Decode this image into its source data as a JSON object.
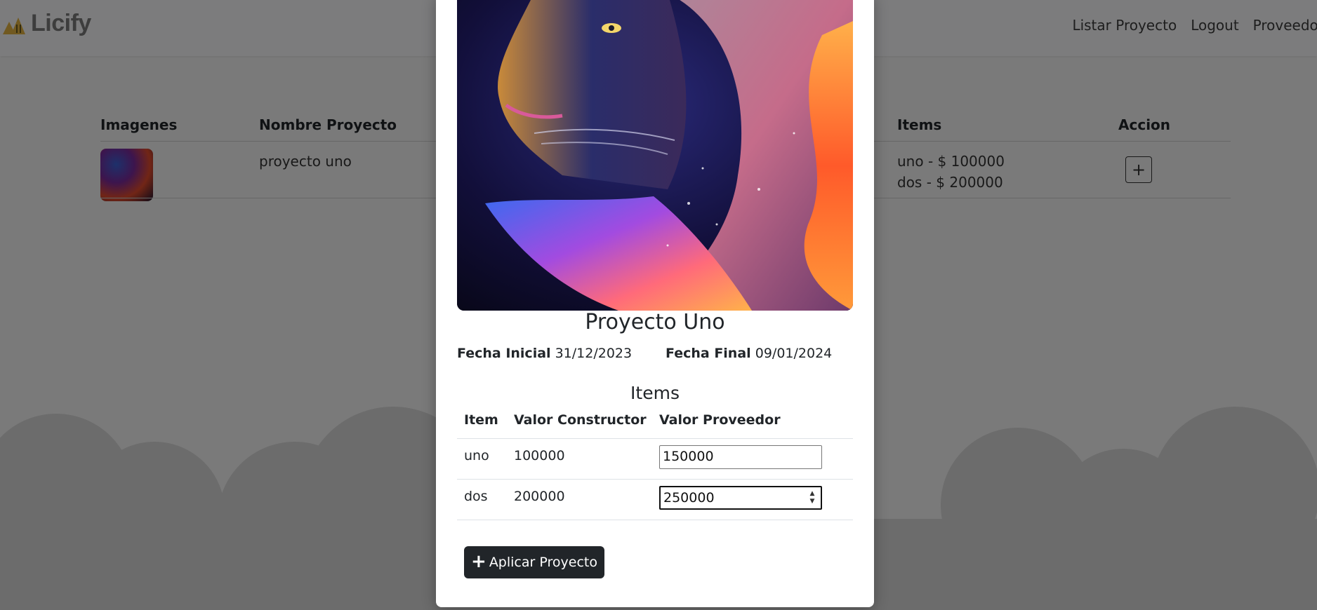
{
  "nav": {
    "brand": "Licify",
    "links": [
      "Listar Proyecto",
      "Logout",
      "Proveedor"
    ]
  },
  "table": {
    "headers": {
      "images": "Imagenes",
      "name": "Nombre Proyecto",
      "items": "Items",
      "action": "Accion"
    },
    "rows": [
      {
        "name": "proyecto uno",
        "items": [
          "uno - $ 100000",
          "dos - $ 200000"
        ],
        "action_icon": "plus-icon"
      }
    ]
  },
  "modal": {
    "title": "Proyecto Uno",
    "fecha_inicial_label": "Fecha Inicial",
    "fecha_inicial": "31/12/2023",
    "fecha_final_label": "Fecha Final",
    "fecha_final": "09/01/2024",
    "items_heading": "Items",
    "columns": [
      "Item",
      "Valor Constructor",
      "Valor Proveedor"
    ],
    "items": [
      {
        "item": "uno",
        "valor_constructor": "100000",
        "valor_proveedor": "150000"
      },
      {
        "item": "dos",
        "valor_constructor": "200000",
        "valor_proveedor": "250000"
      }
    ],
    "apply_label": "Aplicar Proyecto",
    "apply_icon": "plus-icon"
  },
  "colors": {
    "overlay": "rgba(0,0,0,0.5)",
    "button_dark": "#212529",
    "logo_yellow": "#e3b341"
  }
}
